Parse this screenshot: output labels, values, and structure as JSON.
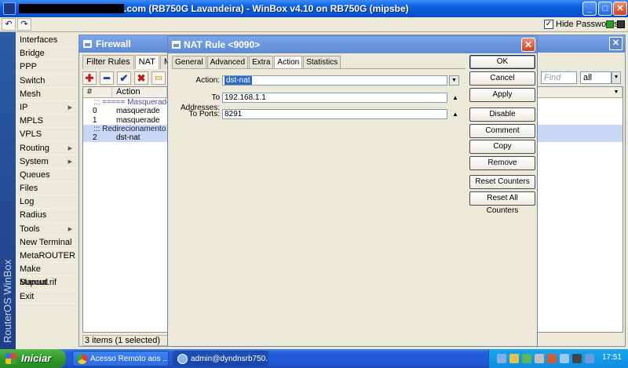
{
  "window": {
    "title": ".com (RB750G Lavandeira) - WinBox v4.10 on RB750G (mipsbe)"
  },
  "toolbar": {
    "undo_icon": "undo-icon",
    "redo_icon": "redo-icon",
    "hide_passwords_label": "Hide Passwords",
    "hide_passwords_checked": true
  },
  "sidebar": {
    "brand": "RouterOS WinBox",
    "items": [
      {
        "label": "Interfaces",
        "submenu": false
      },
      {
        "label": "Bridge",
        "submenu": false
      },
      {
        "label": "PPP",
        "submenu": false
      },
      {
        "label": "Switch",
        "submenu": false
      },
      {
        "label": "Mesh",
        "submenu": false
      },
      {
        "label": "IP",
        "submenu": true
      },
      {
        "label": "MPLS",
        "submenu": false
      },
      {
        "label": "VPLS",
        "submenu": false
      },
      {
        "label": "Routing",
        "submenu": true
      },
      {
        "label": "System",
        "submenu": true
      },
      {
        "label": "Queues",
        "submenu": false
      },
      {
        "label": "Files",
        "submenu": false
      },
      {
        "label": "Log",
        "submenu": false
      },
      {
        "label": "Radius",
        "submenu": false
      },
      {
        "label": "Tools",
        "submenu": true
      },
      {
        "label": "New Terminal",
        "submenu": false
      },
      {
        "label": "MetaROUTER",
        "submenu": false
      },
      {
        "label": "Make Supout.rif",
        "submenu": false
      },
      {
        "label": "Manual",
        "submenu": false
      },
      {
        "label": "Exit",
        "submenu": false
      }
    ]
  },
  "firewall": {
    "title": "Firewall",
    "tabs": [
      "Filter Rules",
      "NAT",
      "Mangle"
    ],
    "active_tab": "NAT",
    "find_placeholder": "Find",
    "filter_value": "all",
    "columns": [
      "#",
      "Action"
    ],
    "rows": [
      {
        "type": "comment",
        "text": "::: ===== Masquerade Inte"
      },
      {
        "type": "rule",
        "num": "0",
        "action": "masquerade"
      },
      {
        "type": "rule",
        "num": "1",
        "action": "masquerade"
      },
      {
        "type": "comment",
        "text": "::: Redirecionamento para"
      },
      {
        "type": "rule",
        "num": "2",
        "action": "dst-nat",
        "selected": true
      }
    ],
    "status": "3 items (1 selected)"
  },
  "nat_rule": {
    "title": "NAT Rule <9090>",
    "tabs": [
      "General",
      "Advanced",
      "Extra",
      "Action",
      "Statistics"
    ],
    "active_tab": "Action",
    "action_label": "Action:",
    "action_value": "dst-nat",
    "to_addresses_label": "To Addresses:",
    "to_addresses_value": "192.168.1.1",
    "to_ports_label": "To Ports:",
    "to_ports_value": "8291",
    "buttons": {
      "ok": "OK",
      "cancel": "Cancel",
      "apply": "Apply",
      "disable": "Disable",
      "comment": "Comment",
      "copy": "Copy",
      "remove": "Remove",
      "reset_counters": "Reset Counters",
      "reset_all_counters": "Reset All Counters"
    }
  },
  "taskbar": {
    "start_label": "Iniciar",
    "items": [
      {
        "label": "Acesso Remoto aos ...",
        "active": false
      },
      {
        "label": "admin@dyndnsrb750....",
        "active": true
      }
    ],
    "clock": "17:51"
  },
  "colors": {
    "titlebar": "#0a5ee2",
    "selection": "#316ac5",
    "row_highlight": "#c8d8f4",
    "taskbar": "#245edb",
    "start_button": "#2f9a2a"
  }
}
